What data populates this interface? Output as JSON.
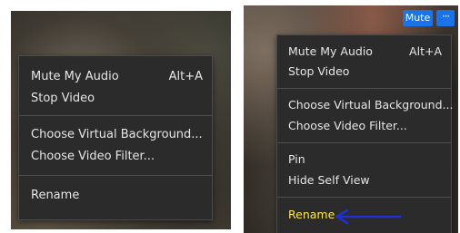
{
  "left_menu": {
    "items": [
      {
        "label": "Mute My Audio",
        "shortcut": "Alt+A"
      },
      {
        "label": "Stop Video"
      },
      {
        "label": "Choose Virtual Background..."
      },
      {
        "label": "Choose Video Filter..."
      },
      {
        "label": "Rename"
      }
    ]
  },
  "right_panel": {
    "mute_label": "Mute",
    "more_label": "···",
    "menu": {
      "items": [
        {
          "label": "Mute My Audio",
          "shortcut": "Alt+A"
        },
        {
          "label": "Stop Video"
        },
        {
          "label": "Choose Virtual Background..."
        },
        {
          "label": "Choose Video Filter..."
        },
        {
          "label": "Pin"
        },
        {
          "label": "Hide Self View"
        },
        {
          "label": "Rename"
        }
      ]
    },
    "highlight_color": "#ffe94a",
    "arrow_color": "#1f2fd0"
  }
}
